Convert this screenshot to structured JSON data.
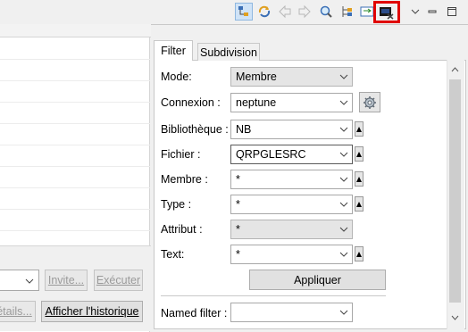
{
  "toolbar": {
    "icons": [
      "hierarchy-icon",
      "sync-icon",
      "back-arrow-icon",
      "forward-arrow-icon",
      "find-icon",
      "tree-icon",
      "swap-icon",
      "terminal-icon",
      "view-menu-icon",
      "minimize-icon",
      "maximize-icon"
    ]
  },
  "left": {
    "buttons": {
      "invite": "Invite...",
      "executer": "Exécuter",
      "details": "étails...",
      "afficher": "Afficher l'historique"
    }
  },
  "tabs": {
    "filter": "Filter",
    "subdivision": "Subdivision"
  },
  "form": {
    "mode": {
      "label": "Mode:",
      "value": "Membre"
    },
    "connexion": {
      "label": "Connexion :",
      "value": "neptune"
    },
    "bibliotheque": {
      "label": "Bibliothèque :",
      "value": "NB"
    },
    "fichier": {
      "label": "Fichier :",
      "value": "QRPGLESRC"
    },
    "membre": {
      "label": "Membre :",
      "value": "*"
    },
    "type": {
      "label": "Type :",
      "value": "*"
    },
    "attribut": {
      "label": "Attribut :",
      "value": "*"
    },
    "text": {
      "label": "Text:",
      "value": "*"
    },
    "apply_label": "Appliquer",
    "named_filter": {
      "label": "Named filter :",
      "value": ""
    }
  },
  "colors": {
    "highlight": "#e00000",
    "selected": "#cfe3f7"
  }
}
